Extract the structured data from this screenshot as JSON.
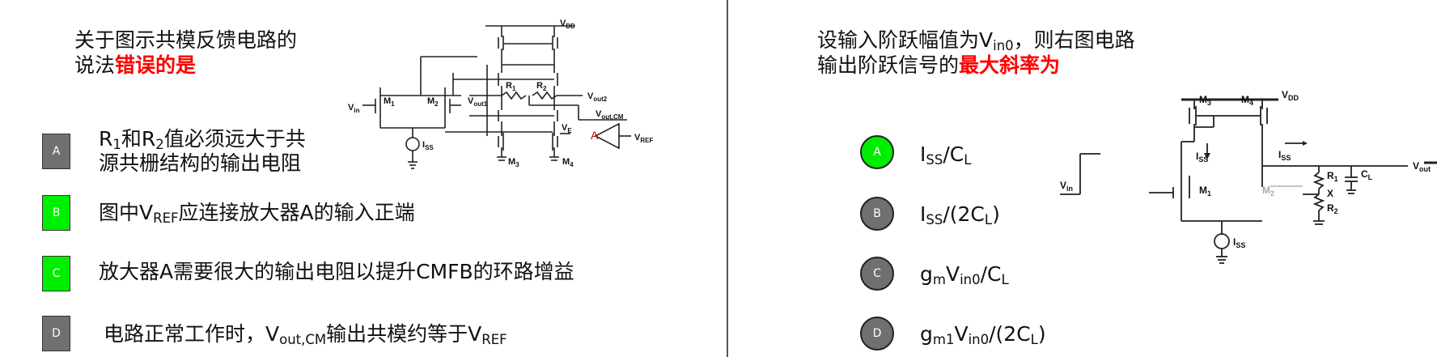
{
  "left": {
    "question": {
      "line1": "关于图示共模反馈电路的",
      "line2_normal": "说法",
      "line2_emph": "错误的是"
    },
    "options": [
      {
        "letter": "A",
        "color": "#707070"
      },
      {
        "letter": "B",
        "color": "#00ee00",
        "pre": "图中V",
        "sub": "REF",
        "post": "应连接放大器A的输入正端"
      },
      {
        "letter": "C",
        "color": "#00ee00",
        "text": "放大器A需要很大的输出电阻以提升CMFB的环路增益"
      },
      {
        "letter": "D",
        "color": "#707070",
        "pre": "电路正常工作时，V",
        "sub": "out,CM",
        "mid": "输出共模约等于V",
        "sub2": "REF"
      }
    ],
    "optionA": {
      "r1": "R",
      "r1sub": "1",
      "and": "和R",
      "r2sub": "2",
      "rest": "值必须远大于共",
      "line2": "源共栅结构的输出电阻"
    },
    "circuit": {
      "vdd": "V",
      "vdd_sub": "DD",
      "vin": "V",
      "vin_sub": "in",
      "m1": "M",
      "m1_sub": "1",
      "m2": "M",
      "m2_sub": "2",
      "vout1": "V",
      "vout1_sub": "out1",
      "vout2": "V",
      "vout2_sub": "out2",
      "r1": "R",
      "r1_sub": "1",
      "r2": "R",
      "r2_sub": "2",
      "voutcm": "V",
      "voutcm_sub": "out,CM",
      "iss": "I",
      "iss_sub": "SS",
      "ve": "V",
      "ve_sub": "E",
      "amp": "A",
      "vref": "V",
      "vref_sub": "REF",
      "m3": "M",
      "m3_sub": "3",
      "m4": "M",
      "m4_sub": "4"
    }
  },
  "right": {
    "question": {
      "line1_pre": "设输入阶跃幅值为V",
      "line1_sub": "in0",
      "line1_post": "，则右图电路",
      "line2_normal": "输出阶跃信号的",
      "line2_emph": "最大斜率为"
    },
    "options": [
      {
        "letter": "A",
        "color": "#00ee00",
        "p1": "I",
        "s1": "SS",
        "p2": "/C",
        "s2": "L",
        "p3": ""
      },
      {
        "letter": "B",
        "color": "#707070",
        "p1": "I",
        "s1": "SS",
        "p2": "/(2C",
        "s2": "L",
        "p3": ")"
      },
      {
        "letter": "C",
        "color": "#707070",
        "p1": "g",
        "s1": "m",
        "p2": "V",
        "s2": "in0",
        "p3": "/C",
        "s3": "L"
      },
      {
        "letter": "D",
        "color": "#707070",
        "p1": "g",
        "s1": "m1",
        "p2": "V",
        "s2": "in0",
        "p3": "/(2C",
        "s3": "L",
        "p4": ")"
      }
    ],
    "circuit": {
      "vdd": "V",
      "vdd_sub": "DD",
      "m3": "M",
      "m3_sub": "3",
      "m4": "M",
      "m4_sub": "4",
      "iss_l": "I",
      "iss_l_sub": "SS",
      "iss_r": "I",
      "iss_r_sub": "SS",
      "vout": "V",
      "vout_sub": "out",
      "vin": "V",
      "vin_sub": "in",
      "m1": "M",
      "m1_sub": "1",
      "m2": "M",
      "m2_sub": "2",
      "r1": "R",
      "r1_sub": "1",
      "x": "X",
      "r2": "R",
      "r2_sub": "2",
      "cl": "C",
      "cl_sub": "L",
      "iss_b": "I",
      "iss_b_sub": "SS"
    }
  }
}
